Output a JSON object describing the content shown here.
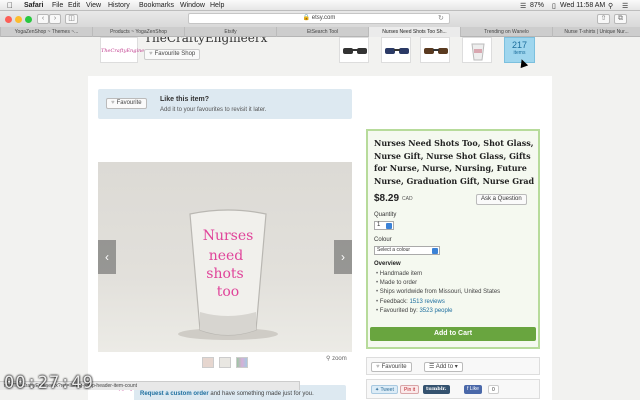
{
  "menubar": {
    "app": "Safari",
    "items": [
      "File",
      "Edit",
      "View",
      "History",
      "Bookmarks",
      "Window",
      "Help"
    ],
    "status": {
      "battery": "87%",
      "clock": "Wed 11:58 AM"
    }
  },
  "toolbar": {
    "url": "etsy.com"
  },
  "tabs": [
    {
      "label": "YogaZenShop ~ Themes ~..."
    },
    {
      "label": "Products ~ YogaZenShop"
    },
    {
      "label": "Etsify"
    },
    {
      "label": "EtSearch Tool"
    },
    {
      "label": "Nurses Need Shots Too Sh..."
    },
    {
      "label": "Trending on Wanelo"
    },
    {
      "label": "Nurse T-shirts | Unique Nur..."
    }
  ],
  "shop": {
    "logo_text": "TheCraftyEngineerx",
    "name": "TheCraftyEngineerx",
    "favourite_shop": "Favourite Shop",
    "items_count": "217",
    "items_label": "items"
  },
  "favourite_prompt": {
    "button": "Favourite",
    "title": "Like this item?",
    "subtitle": "Add it to your favourites to revisit it later."
  },
  "photo": {
    "glass_text": [
      "Nurses",
      "need",
      "shots",
      "too"
    ],
    "zoom": "zoom"
  },
  "custom_order": {
    "link": "Request a custom order",
    "rest": " and have something made just for you."
  },
  "listing": {
    "title": "Nurses Need Shots Too, Shot Glass, Nurse Gift, Nurse Shot Glass, Gifts for Nurse, Nurse, Nursing, Future Nurse, Graduation Gift, Nurse Grad",
    "price": "$8.29",
    "currency": "CAD",
    "ask_question": "Ask a Question",
    "quantity_label": "Quantity",
    "quantity_value": "1",
    "colour_label": "Colour",
    "colour_placeholder": "Select a colour",
    "overview_title": "Overview",
    "overview": {
      "handmade": "Handmade item",
      "made_to_order": "Made to order",
      "ships": "Ships worldwide from Missouri, United States",
      "feedback_label": "Feedback: ",
      "feedback_link": "1513 reviews",
      "favourited_label": "Favourited by: ",
      "favourited_link": "3523 people"
    },
    "add_to_cart": "Add to Cart"
  },
  "actions": {
    "favourite": "Favourite",
    "add_to": "Add to"
  },
  "social": {
    "tweet": "Tweet",
    "pin": "Pin it",
    "tumblr": "tumblr.",
    "like": "Like",
    "like_count": "0"
  },
  "statusbar": {
    "url": "ngs/TheCraftyEngineerx?ref=listing-shop-header-item-count"
  },
  "timer": "00:27:49",
  "colors": {
    "accent_green": "#69a53f",
    "link_blue": "#1e6f9f",
    "glass_pink": "#e0449a",
    "favourite_bg": "#dde9f1"
  }
}
